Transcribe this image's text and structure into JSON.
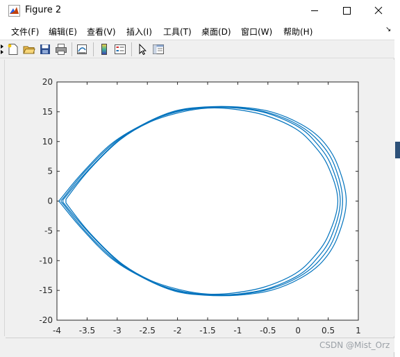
{
  "window": {
    "title": "Figure 2",
    "controls": [
      "minimize",
      "maximize",
      "close"
    ]
  },
  "menu": {
    "items": [
      {
        "label": "文件(F)"
      },
      {
        "label": "编辑(E)"
      },
      {
        "label": "查看(V)"
      },
      {
        "label": "插入(I)"
      },
      {
        "label": "工具(T)"
      },
      {
        "label": "桌面(D)"
      },
      {
        "label": "窗口(W)"
      },
      {
        "label": "帮助(H)"
      }
    ],
    "overflow_glyph": "↘"
  },
  "toolbar": {
    "buttons": [
      "new-figure-icon",
      "open-file-icon",
      "save-icon",
      "print-icon",
      "link-plot-icon",
      "insert-colorbar-icon",
      "insert-legend-icon",
      "edit-plot-arrow-icon",
      "property-inspector-icon"
    ]
  },
  "chart_data": {
    "type": "line",
    "title": "",
    "xlabel": "",
    "ylabel": "",
    "xlim": [
      -4,
      1
    ],
    "ylim": [
      -20,
      20
    ],
    "x_ticks": [
      "-4",
      "-3.5",
      "-3",
      "-2.5",
      "-2",
      "-1.5",
      "-1",
      "-0.5",
      "0",
      "0.5",
      "1"
    ],
    "y_ticks": [
      "20",
      "15",
      "10",
      "5",
      "0",
      "-5",
      "-10",
      "-15",
      "-20"
    ],
    "grid": false,
    "line_color": "#0072bd",
    "series": [
      {
        "x": [
          0.7,
          0.55,
          0.3,
          0.0,
          -0.5,
          -1.0,
          -1.5,
          -2.0,
          -2.5,
          -3.0,
          -3.5,
          -3.85,
          -3.9,
          -3.85,
          -3.5,
          -3.0,
          -2.5,
          -2.0,
          -1.5,
          -1.0,
          -0.5,
          0.0,
          0.3,
          0.55,
          0.7
        ],
        "y": [
          0.0,
          6.0,
          9.8,
          12.5,
          14.7,
          15.6,
          15.7,
          15.0,
          13.2,
          10.0,
          5.0,
          0.8,
          0.0,
          -0.8,
          -5.0,
          -10.0,
          -13.2,
          -15.0,
          -15.7,
          -15.6,
          -14.7,
          -12.5,
          -9.8,
          -6.0,
          0.0
        ]
      },
      {
        "x": [
          0.8,
          0.65,
          0.4,
          0.05,
          -0.45,
          -1.0,
          -1.55,
          -2.05,
          -2.55,
          -3.1,
          -3.6,
          -3.92,
          -3.96,
          -3.92,
          -3.6,
          -3.1,
          -2.55,
          -2.05,
          -1.55,
          -1.0,
          -0.45,
          0.05,
          0.4,
          0.65,
          0.8
        ],
        "y": [
          0.0,
          6.2,
          10.2,
          12.9,
          15.0,
          15.8,
          15.8,
          15.1,
          13.0,
          9.6,
          4.5,
          0.6,
          0.0,
          -0.6,
          -4.5,
          -9.6,
          -13.0,
          -15.1,
          -15.8,
          -15.8,
          -15.0,
          -12.9,
          -10.2,
          -6.2,
          0.0
        ]
      },
      {
        "x": [
          0.66,
          0.5,
          0.25,
          -0.05,
          -0.55,
          -1.05,
          -1.5,
          -1.95,
          -2.45,
          -2.95,
          -3.45,
          -3.8,
          -3.85,
          -3.8,
          -3.45,
          -2.95,
          -2.45,
          -1.95,
          -1.5,
          -1.05,
          -0.55,
          -0.05,
          0.25,
          0.5,
          0.66
        ],
        "y": [
          0.0,
          5.8,
          9.5,
          12.2,
          14.4,
          15.4,
          15.6,
          14.9,
          13.3,
          10.3,
          5.4,
          1.0,
          0.0,
          -1.0,
          -5.4,
          -10.3,
          -13.3,
          -14.9,
          -15.6,
          -15.4,
          -14.4,
          -12.2,
          -9.5,
          -5.8,
          0.0
        ]
      },
      {
        "x": [
          0.74,
          0.6,
          0.35,
          0.02,
          -0.48,
          -1.02,
          -1.52,
          -2.02,
          -2.52,
          -3.05,
          -3.55,
          -3.88,
          -3.93,
          -3.88,
          -3.55,
          -3.05,
          -2.52,
          -2.02,
          -1.52,
          -1.02,
          -0.48,
          0.02,
          0.35,
          0.6,
          0.74
        ],
        "y": [
          0.0,
          6.1,
          10.0,
          12.7,
          14.8,
          15.7,
          15.75,
          15.05,
          13.1,
          9.8,
          4.8,
          0.7,
          0.0,
          -0.7,
          -4.8,
          -9.8,
          -13.1,
          -15.05,
          -15.75,
          -15.7,
          -14.8,
          -12.7,
          -10.0,
          -6.1,
          0.0
        ]
      }
    ]
  },
  "watermark": "CSDN @Mist_Orz"
}
